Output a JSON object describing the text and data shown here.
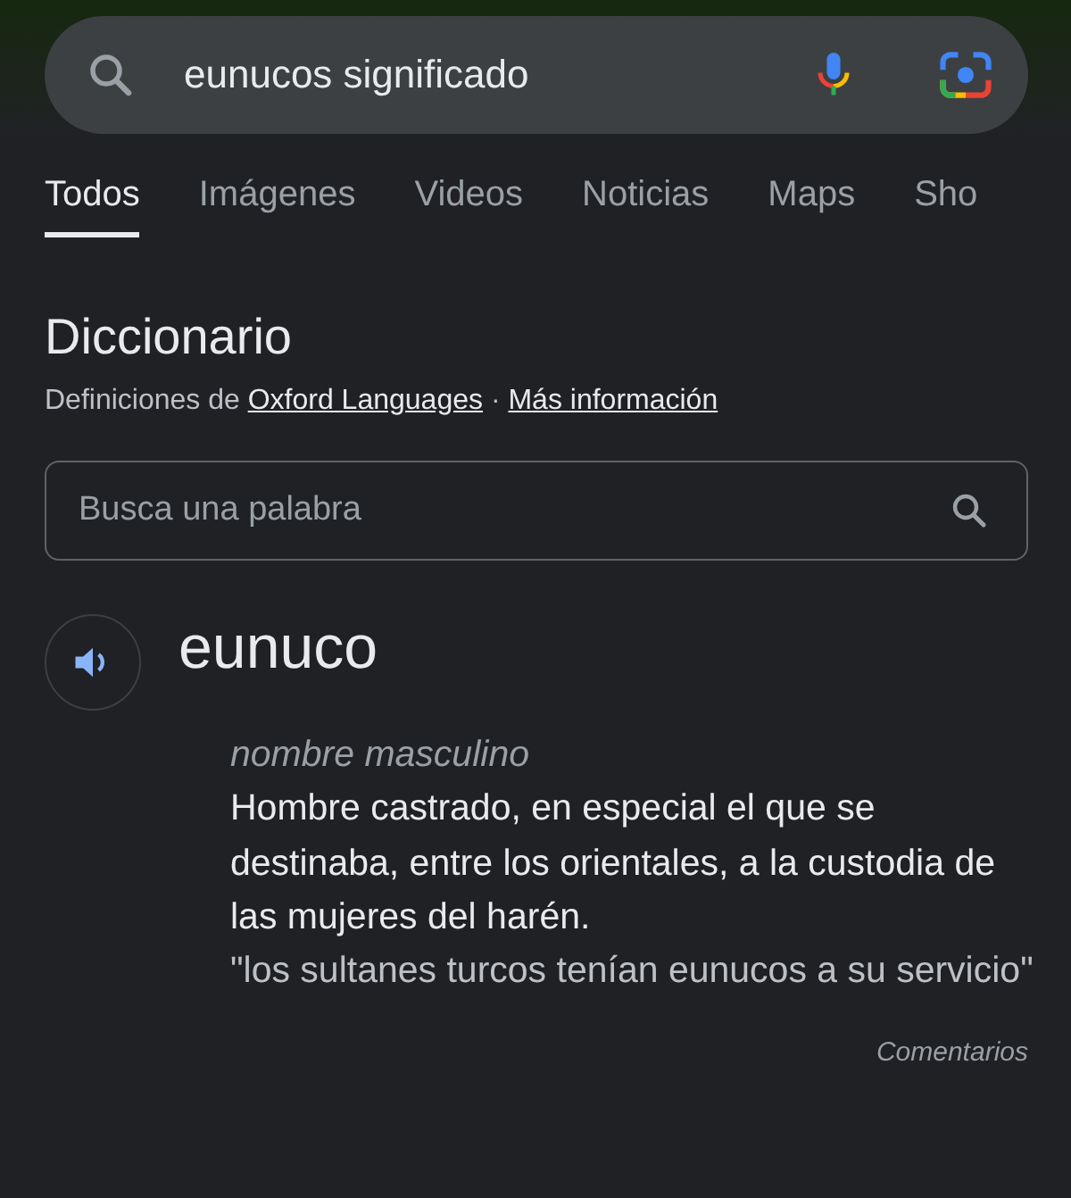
{
  "search": {
    "value": "eunucos significado"
  },
  "tabs": [
    {
      "label": "Todos",
      "selected": true
    },
    {
      "label": "Imágenes",
      "selected": false
    },
    {
      "label": "Videos",
      "selected": false
    },
    {
      "label": "Noticias",
      "selected": false
    },
    {
      "label": "Maps",
      "selected": false
    },
    {
      "label": "Sho",
      "selected": false
    }
  ],
  "dictionary": {
    "title": "Diccionario",
    "source_prefix": "Definiciones de",
    "source_link": "Oxford Languages",
    "separator": "·",
    "more_link": "Más información",
    "word_search": {
      "placeholder": "Busca una palabra"
    },
    "word": "eunuco",
    "part_of_speech": "nombre masculino",
    "definition": "Hombre castrado, en especial el que se destinaba, entre los orientales, a la custodia de las mujeres del harén.",
    "example": "\"los sultanes turcos tenían eunucos a su servicio\""
  },
  "feedback": "Comentarios"
}
